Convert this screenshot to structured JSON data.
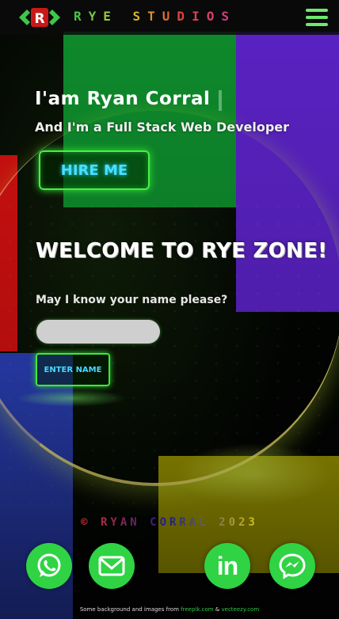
{
  "header": {
    "brand": "RYE STUDIOS",
    "logo_letter": "R",
    "menu_icon": "hamburger-icon"
  },
  "hero": {
    "title": "I'am Ryan Corral",
    "subtitle": "And I'm a Full Stack Web Developer",
    "hire_label": "HIRE ME"
  },
  "welcome": {
    "heading": "WELCOME TO RYE ZONE!",
    "question": "May I know your name please?",
    "name_value": "",
    "enter_label": "ENTER NAME"
  },
  "footer": {
    "copyright": "© RYAN CORRAL 2023",
    "social": [
      {
        "name": "whatsapp",
        "icon": "whatsapp-icon"
      },
      {
        "name": "email",
        "icon": "email-icon"
      },
      {
        "name": "linkedin",
        "icon": "linkedin-icon",
        "text": "in"
      },
      {
        "name": "messenger",
        "icon": "messenger-icon"
      }
    ],
    "credit_prefix": "Some background and images from",
    "credit_link1": "freepik.com",
    "credit_amp": "&",
    "credit_link2": "vecteezy.com"
  },
  "colors": {
    "accent_green": "#2fd344",
    "neon_cyan": "#48e0ff",
    "block_green": "#0e8a2c",
    "block_purple": "#5a22c4",
    "block_red": "#d01010",
    "block_blue": "#2a3fb6",
    "block_yellow": "#a6a000"
  }
}
